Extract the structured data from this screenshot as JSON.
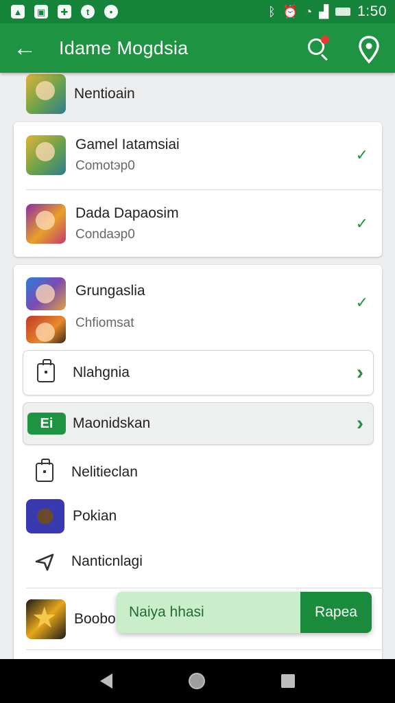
{
  "status_bar": {
    "time": "1:50",
    "left_icons": [
      "image-icon",
      "gallery-icon",
      "game-controller-icon",
      "twitter-icon",
      "notification-dot-icon"
    ],
    "right_icons": [
      "bluetooth-icon",
      "alarm-icon",
      "wifi-icon",
      "signal-icon",
      "battery-icon"
    ]
  },
  "app_bar": {
    "title": "Idame Mogdsia",
    "back_icon": "arrow-back-icon",
    "search_icon": "search-icon",
    "location_icon": "location-pin-icon",
    "accent": "#1e9342",
    "badge_color": "#e53935"
  },
  "list": {
    "partial_item": {
      "title": "Nentioain"
    },
    "card_one": [
      {
        "title": "Gamel Iatamsiai",
        "subtitle": "Comotэp0",
        "checked": true
      },
      {
        "title": "Dada Dapaosim",
        "subtitle": "Condaэp0",
        "checked": true
      }
    ],
    "card_two": {
      "header": {
        "title": "Grungaslia",
        "subtitle": "Chfiomsat",
        "checked": true
      },
      "sub_cards": [
        {
          "label": "Nlahgnia",
          "icon": "bag-icon"
        },
        {
          "label": "Maonidskan",
          "chip": "Ei"
        }
      ],
      "items": [
        {
          "label": "Nelitieclan",
          "icon": "bag-icon"
        },
        {
          "label": "Pokian",
          "icon": "monkey-thumbnail"
        },
        {
          "label": "Nanticnlagi",
          "icon": "navigation-arrow-icon"
        }
      ],
      "footer_item": {
        "label": "Boobo"
      }
    }
  },
  "snackbar": {
    "message": "Naiya hhasi",
    "action": "Rapea"
  }
}
